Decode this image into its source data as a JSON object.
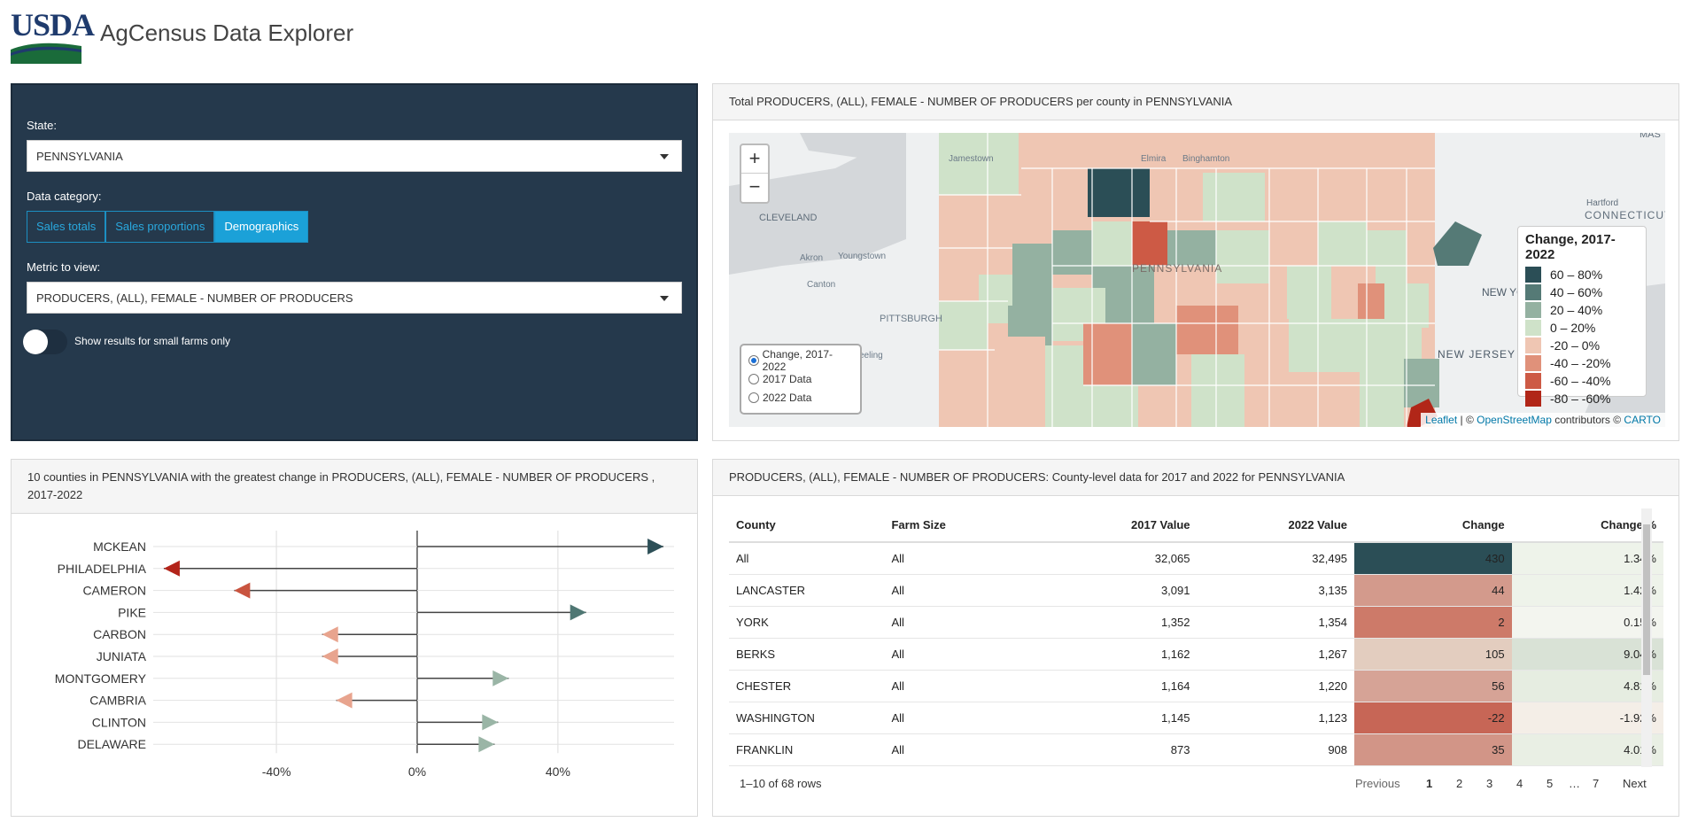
{
  "header": {
    "logo_text": "USDA",
    "title": "AgCensus Data Explorer"
  },
  "sidebar": {
    "state_label": "State:",
    "state_value": "PENNSYLVANIA",
    "category_label": "Data category:",
    "categories": [
      {
        "label": "Sales totals",
        "active": false
      },
      {
        "label": "Sales proportions",
        "active": false
      },
      {
        "label": "Demographics",
        "active": true
      }
    ],
    "metric_label": "Metric to view:",
    "metric_value": "PRODUCERS, (ALL), FEMALE - NUMBER OF PRODUCERS",
    "toggle_label": "Show results for small farms only",
    "toggle_on": false
  },
  "map_panel": {
    "title": "Total PRODUCERS, (ALL), FEMALE - NUMBER OF PRODUCERS per county in PENNSYLVANIA",
    "zoom_in": "+",
    "zoom_out": "−",
    "radio_options": [
      {
        "label": "Change, 2017-2022",
        "selected": true
      },
      {
        "label": "2017 Data",
        "selected": false
      },
      {
        "label": "2022 Data",
        "selected": false
      }
    ],
    "legend_title": "Change, 2017-2022",
    "legend": [
      {
        "label": "60 – 80%",
        "color": "#2b4e56"
      },
      {
        "label": "40 – 60%",
        "color": "#557a76"
      },
      {
        "label": "20 – 40%",
        "color": "#94b1a1"
      },
      {
        "label": "0 – 20%",
        "color": "#cfe2c9"
      },
      {
        "label": "-20 – 0%",
        "color": "#efc6b3"
      },
      {
        "label": "-40 – -20%",
        "color": "#e0917a"
      },
      {
        "label": "-60 – -40%",
        "color": "#cd5a45"
      },
      {
        "label": "-80 – -60%",
        "color": "#b12618"
      }
    ],
    "map_labels": [
      "Jamestown",
      "Elmira",
      "Binghamton",
      "CLEVELAND",
      "Akron",
      "Youngstown",
      "Canton",
      "PITTSBURGH",
      "Wheeling",
      "PENNSYLVANIA",
      "Hartford",
      "CONNECTICUT",
      "NEW YORK",
      "NEW JERSEY",
      "MAS"
    ],
    "attribution_leaflet": "Leaflet",
    "attribution_mid": " | © ",
    "attribution_osm": "OpenStreetMap",
    "attribution_contrib": " contributors © ",
    "attribution_carto": "CARTO"
  },
  "chart_panel": {
    "title": "10 counties in PENNSYLVANIA with the greatest change in PRODUCERS, (ALL), FEMALE - NUMBER OF PRODUCERS , 2017-2022"
  },
  "chart_data": {
    "type": "lollipop-arrow",
    "categories": [
      "MCKEAN",
      "PHILADELPHIA",
      "CAMERON",
      "PIKE",
      "CARBON",
      "JUNIATA",
      "MONTGOMERY",
      "CAMBRIA",
      "CLINTON",
      "DELAWARE"
    ],
    "values": [
      70,
      -72,
      -52,
      48,
      -27,
      -27,
      26,
      -23,
      23,
      22
    ],
    "x_ticks": [
      -40,
      0,
      40
    ],
    "x_tick_labels": [
      "-40%",
      "0%",
      "40%"
    ],
    "xlim": [
      -75,
      73
    ],
    "colors": {
      "pos_high": "#2d4f57",
      "pos_mid": "#4f7773",
      "pos_low": "#9ab5a6",
      "neg_high": "#b3241a",
      "neg_mid": "#c9543f",
      "neg_low": "#e8a48e"
    }
  },
  "table_panel": {
    "title": "PRODUCERS, (ALL), FEMALE - NUMBER OF PRODUCERS: County-level data for 2017 and 2022 for PENNSYLVANIA",
    "columns": [
      "County",
      "Farm Size",
      "2017 Value",
      "2022 Value",
      "Change",
      "Change %"
    ],
    "rows": [
      {
        "county": "All",
        "size": "All",
        "v2017": "32,065",
        "v2022": "32,495",
        "change": "430",
        "pct": "1.34%",
        "change_bg": "#2b4e56",
        "pct_bg": "#eef3ea"
      },
      {
        "county": "LANCASTER",
        "size": "All",
        "v2017": "3,091",
        "v2022": "3,135",
        "change": "44",
        "pct": "1.42%",
        "change_bg": "#d39a8c",
        "pct_bg": "#eef3ea"
      },
      {
        "county": "YORK",
        "size": "All",
        "v2017": "1,352",
        "v2022": "1,354",
        "change": "2",
        "pct": "0.15%",
        "change_bg": "#cd7a69",
        "pct_bg": "#f3f5ef"
      },
      {
        "county": "BERKS",
        "size": "All",
        "v2017": "1,162",
        "v2022": "1,267",
        "change": "105",
        "pct": "9.04%",
        "change_bg": "#e3cdbf",
        "pct_bg": "#d9e2d6"
      },
      {
        "county": "CHESTER",
        "size": "All",
        "v2017": "1,164",
        "v2022": "1,220",
        "change": "56",
        "pct": "4.81%",
        "change_bg": "#d6a396",
        "pct_bg": "#e6ede1"
      },
      {
        "county": "WASHINGTON",
        "size": "All",
        "v2017": "1,145",
        "v2022": "1,123",
        "change": "-22",
        "pct": "-1.92%",
        "change_bg": "#c76656",
        "pct_bg": "#f4eee7"
      },
      {
        "county": "FRANKLIN",
        "size": "All",
        "v2017": "873",
        "v2022": "908",
        "change": "35",
        "pct": "4.01%",
        "change_bg": "#d29587",
        "pct_bg": "#e9efe4"
      }
    ],
    "info": "1–10 of 68 rows",
    "pager": [
      "Previous",
      "1",
      "2",
      "3",
      "4",
      "5",
      "…",
      "7",
      "Next"
    ]
  }
}
